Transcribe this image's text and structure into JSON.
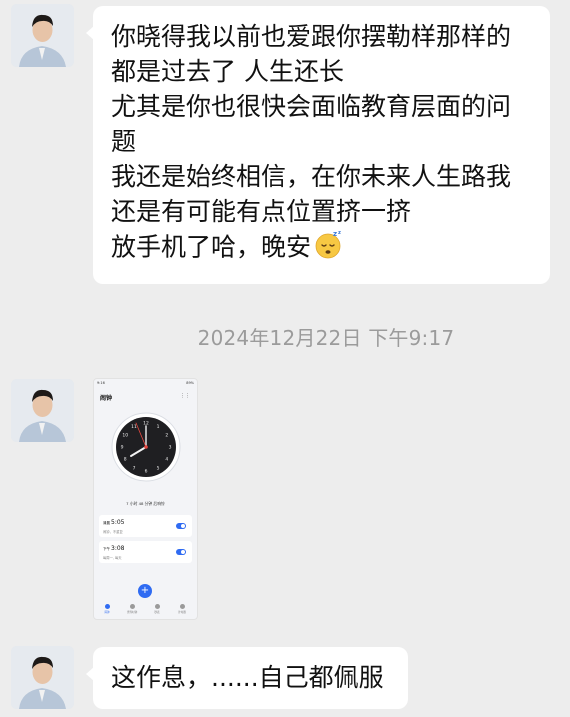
{
  "messages": [
    {
      "lines": [
        "你晓得我以前也爱跟你摆勒样那样的",
        "都是过去了 人生还长",
        "尤其是你也很快会面临教育层面的问",
        "题",
        "我还是始终相信，在你未来人生路我",
        "还是有可能有点位置挤一挤",
        "放手机了哈，晚安"
      ],
      "emoji": "sleeping-face-icon"
    },
    {
      "type": "image",
      "screenshot": {
        "status_left": "9:16",
        "status_right": "89%",
        "app_title": "闹钟",
        "remaining_text": "7 小时 48 分钟 后响铃",
        "alarms": [
          {
            "period": "清晨",
            "time": "5:05",
            "repeat": "闹钟，不重复",
            "enabled": true
          },
          {
            "period": "下午",
            "time": "3:08",
            "repeat": "每周一, 每天",
            "enabled": true
          }
        ],
        "tabs": [
          {
            "label": "闹钟",
            "active": true
          },
          {
            "label": "世界时钟",
            "active": false
          },
          {
            "label": "秒表",
            "active": false
          },
          {
            "label": "计时器",
            "active": false
          }
        ],
        "clock_numbers": [
          "12",
          "1",
          "2",
          "3",
          "4",
          "5",
          "6",
          "7",
          "8",
          "9",
          "10",
          "11"
        ]
      }
    },
    {
      "lines": [
        "这作息，......自己都佩服"
      ]
    }
  ],
  "timestamp": "2024年12月22日 下午9:17",
  "colors": {
    "background": "#ededed",
    "bubble": "#ffffff",
    "accent": "#2f6bf2",
    "timestamp": "#9b9b9b"
  }
}
